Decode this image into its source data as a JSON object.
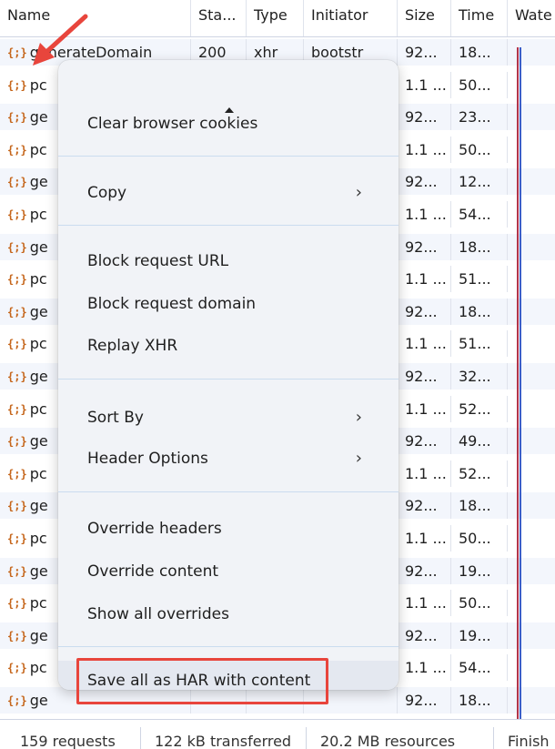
{
  "network": {
    "columns": [
      "Name",
      "Sta...",
      "Type",
      "Initiator",
      "Size",
      "Time",
      "Wate"
    ],
    "rows": [
      {
        "name": "generateDomain",
        "status": "200",
        "type": "xhr",
        "initiator": "bootstr",
        "size": "92...",
        "time": "18..."
      },
      {
        "name": "pc",
        "size": "1.1 ...",
        "time": "50..."
      },
      {
        "name": "ge",
        "size": "92...",
        "time": "23..."
      },
      {
        "name": "pc",
        "size": "1.1 ...",
        "time": "50..."
      },
      {
        "name": "ge",
        "size": "92...",
        "time": "12..."
      },
      {
        "name": "pc",
        "size": "1.1 ...",
        "time": "54..."
      },
      {
        "name": "ge",
        "size": "92...",
        "time": "18..."
      },
      {
        "name": "pc",
        "size": "1.1 ...",
        "time": "51..."
      },
      {
        "name": "ge",
        "size": "92...",
        "time": "18..."
      },
      {
        "name": "pc",
        "size": "1.1 ...",
        "time": "51..."
      },
      {
        "name": "ge",
        "size": "92...",
        "time": "32..."
      },
      {
        "name": "pc",
        "size": "1.1 ...",
        "time": "52..."
      },
      {
        "name": "ge",
        "size": "92...",
        "time": "49..."
      },
      {
        "name": "pc",
        "size": "1.1 ...",
        "time": "52..."
      },
      {
        "name": "ge",
        "size": "92...",
        "time": "18..."
      },
      {
        "name": "pc",
        "size": "1.1 ...",
        "time": "50..."
      },
      {
        "name": "ge",
        "size": "92...",
        "time": "19..."
      },
      {
        "name": "pc",
        "size": "1.1 ...",
        "time": "50..."
      },
      {
        "name": "ge",
        "size": "92...",
        "time": "19..."
      },
      {
        "name": "pc",
        "size": "1.1 ...",
        "time": "54..."
      },
      {
        "name": "ge",
        "size": "92...",
        "time": "18..."
      }
    ],
    "row_icon": "{;}"
  },
  "status_bar": {
    "requests": "159 requests",
    "transferred": "122 kB transferred",
    "resources": "20.2 MB resources",
    "finish": "Finish"
  },
  "context_menu": {
    "clear_cookies": "Clear browser cookies",
    "copy": "Copy",
    "block_url": "Block request URL",
    "block_domain": "Block request domain",
    "replay_xhr": "Replay XHR",
    "sort_by": "Sort By",
    "header_options": "Header Options",
    "override_headers": "Override headers",
    "override_content": "Override content",
    "show_overrides": "Show all overrides",
    "save_har": "Save all as HAR with content",
    "submenu_chevron": "›"
  },
  "colors": {
    "annotation_red": "#e8453c",
    "waterfall_red": "#b2344a",
    "waterfall_blue": "#3b5fc9",
    "icon_orange": "#c5651a"
  }
}
